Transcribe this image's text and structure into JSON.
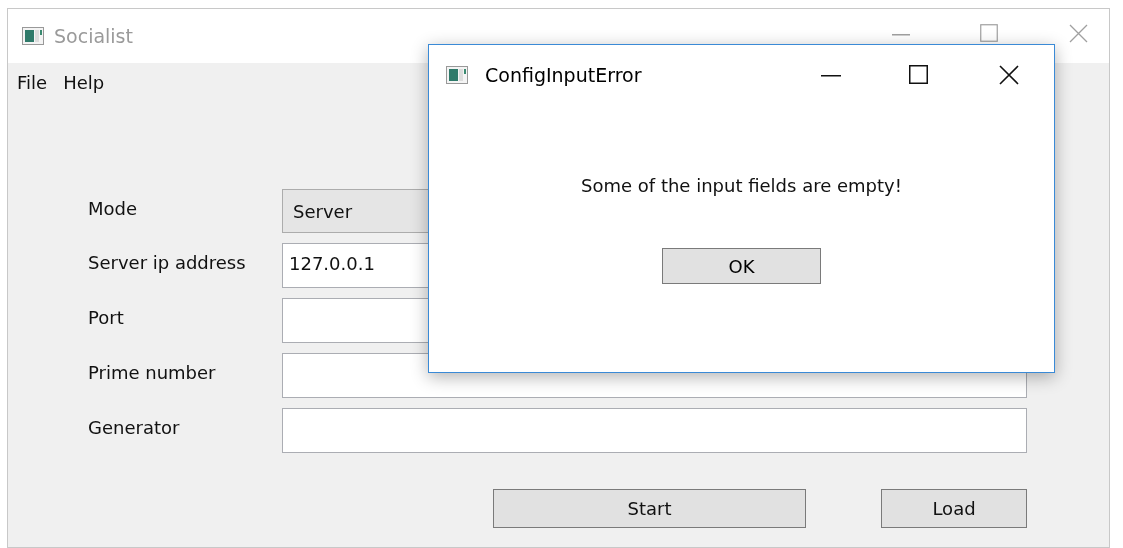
{
  "window": {
    "title": "Socialist",
    "active": false
  },
  "menu": [
    "File",
    "Help"
  ],
  "form": [
    {
      "label": "Mode",
      "kind": "dropdown",
      "value": "Server"
    },
    {
      "label": "Server ip address",
      "kind": "text",
      "value": "127.0.0.1"
    },
    {
      "label": "Port",
      "kind": "text"
    },
    {
      "label": "Prime number",
      "kind": "text"
    },
    {
      "label": "Generator",
      "kind": "text"
    }
  ],
  "buttons": [
    "Start",
    "Load"
  ],
  "dialog": {
    "title": "ConfigInputError",
    "active": true,
    "message": "Some of the input fields are empty!",
    "button": "OK"
  }
}
